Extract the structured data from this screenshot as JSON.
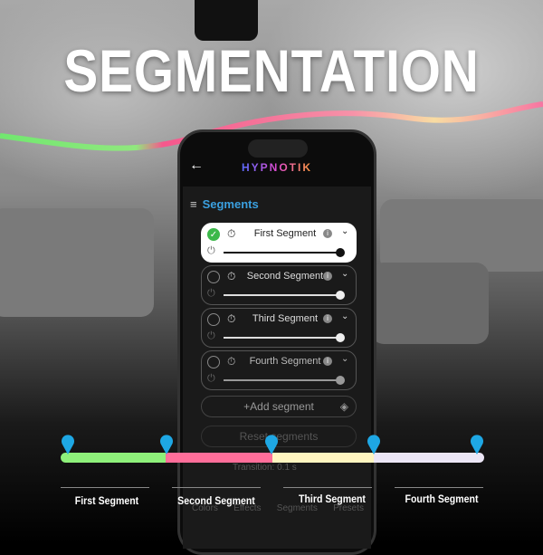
{
  "headline": "SEGMENTATION",
  "app": {
    "logo": "HYPNOTIK",
    "section_title": "Segments",
    "segments": [
      {
        "name": "First Segment",
        "selected": true,
        "brightness": 1.0
      },
      {
        "name": "Second Segment",
        "selected": false,
        "brightness": 1.0
      },
      {
        "name": "Third Segment",
        "selected": false,
        "brightness": 1.0
      },
      {
        "name": "Fourth Segment",
        "selected": false,
        "brightness": 1.0
      }
    ],
    "add_segment": "+Add segment",
    "reset_segments": "Reset segments",
    "transition_label": "Transition:",
    "transition_value": "0.1",
    "transition_unit": "s",
    "nav": [
      "Colors",
      "Effects",
      "Segments",
      "Presets"
    ]
  },
  "strip": {
    "segments": [
      {
        "label": "First Segment",
        "color": "#8ef07a"
      },
      {
        "label": "Second Segment",
        "color": "#ff6e9a"
      },
      {
        "label": "Third Segment",
        "color": "#fff5c0"
      },
      {
        "label": "Fourth Segment",
        "color": "#ece6f6"
      }
    ],
    "pin_color": "#1ea7e4"
  }
}
